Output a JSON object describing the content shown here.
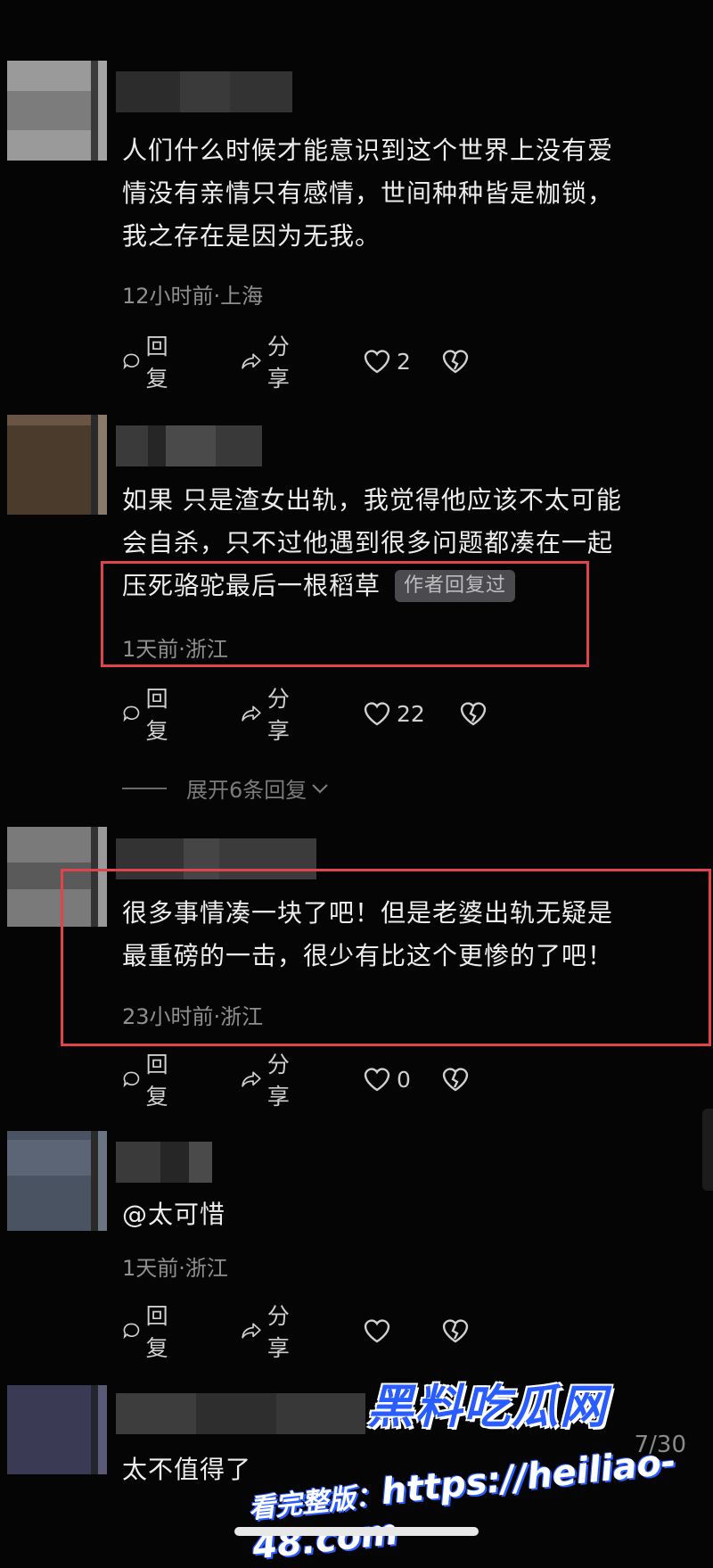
{
  "colors": {
    "background": "#050505",
    "highlight": "#e0444b",
    "meta": "#8f8f8f",
    "watermark_blue": "#2a5dff"
  },
  "comments": [
    {
      "text_lines": [
        "人们什么时候才能意识到这个世界上没有爱",
        "情没有亲情只有感情，世间种种皆是枷锁，",
        "我之存在是因为无我。"
      ],
      "meta": "12小时前·上海",
      "actions": {
        "reply": "回复",
        "share": "分享",
        "likes": "2"
      }
    },
    {
      "text_lines": [
        "如果 只是渣女出轨，我觉得他应该不太可能",
        "会自杀，只不过他遇到很多问题都凑在一起",
        "压死骆驼最后一根稻草"
      ],
      "badge": "作者回复过",
      "meta": "1天前·浙江",
      "actions": {
        "reply": "回复",
        "share": "分享",
        "likes": "22"
      },
      "expand": "展开6条回复"
    },
    {
      "text_lines": [
        "很多事情凑一块了吧！但是老婆出轨无疑是",
        "最重磅的一击，很少有比这个更惨的了吧！"
      ],
      "meta": "23小时前·浙江",
      "actions": {
        "reply": "回复",
        "share": "分享",
        "likes": "0"
      }
    },
    {
      "text_lines": [
        "@太可惜"
      ],
      "meta": "1天前·浙江",
      "actions": {
        "reply": "回复",
        "share": "分享",
        "likes": ""
      }
    },
    {
      "text_lines": [
        "太不值得了"
      ]
    }
  ],
  "page_indicator": "7/30",
  "watermark": {
    "title": "黑料吃瓜网",
    "url_prefix": "看完整版：",
    "url": "https://heiliao-48.com"
  }
}
